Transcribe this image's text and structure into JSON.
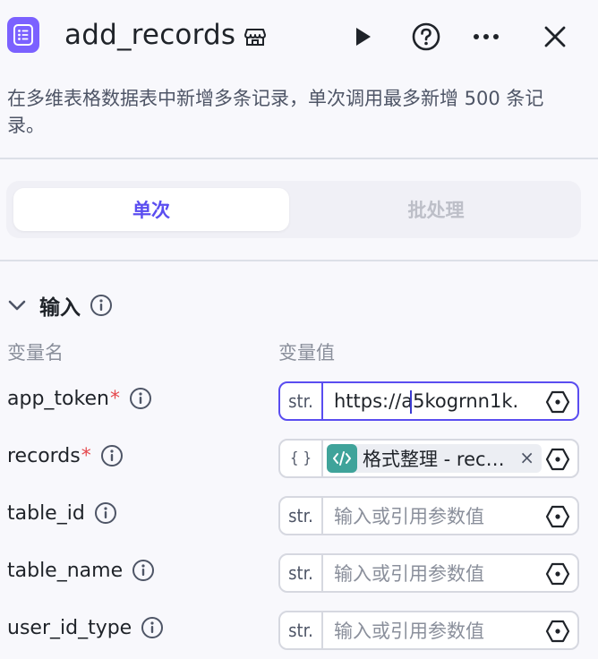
{
  "header": {
    "title": "add_records"
  },
  "description": "在多维表格数据表中新增多条记录，单次调用最多新增 500 条记录。",
  "mode_tabs": [
    {
      "label": "单次",
      "active": true
    },
    {
      "label": "批处理",
      "active": false
    }
  ],
  "input_section": {
    "title": "输入",
    "col_name": "变量名",
    "col_value": "变量值"
  },
  "params": [
    {
      "name": "app_token",
      "required": true,
      "type": "str.",
      "value": "https://a5kogrnn1k.",
      "placeholder": ""
    },
    {
      "name": "records",
      "required": true,
      "type": "{ }",
      "reference": "格式整理 - rec…",
      "placeholder": ""
    },
    {
      "name": "table_id",
      "required": false,
      "type": "str.",
      "value": "",
      "placeholder": "输入或引用参数值"
    },
    {
      "name": "table_name",
      "required": false,
      "type": "str.",
      "value": "",
      "placeholder": "输入或引用参数值"
    },
    {
      "name": "user_id_type",
      "required": false,
      "type": "str.",
      "value": "",
      "placeholder": "输入或引用参数值"
    }
  ],
  "colors": {
    "accent": "#5a4df0",
    "app_icon": "#7b61ff",
    "tag_icon": "#3fa39a",
    "required": "#e5484d"
  },
  "icons": [
    "list-doc-icon",
    "store-icon",
    "play-icon",
    "help-icon",
    "more-icon",
    "close-icon",
    "chevron-down-icon",
    "info-icon",
    "code-icon",
    "hexagon-circle-icon"
  ]
}
